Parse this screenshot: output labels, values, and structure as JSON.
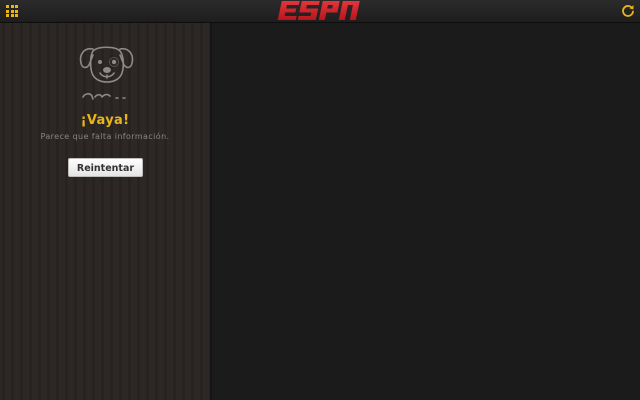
{
  "header": {
    "logo_text": "ESPN",
    "menu_icon": "grid-icon",
    "refresh_icon": "refresh-icon",
    "accent_color": "#e8b619",
    "logo_color": "#d3232a"
  },
  "sidebar": {
    "illustration": "dog-icon",
    "heading": "¡Vaya!",
    "message": "Parece que falta información.",
    "retry_label": "Reintentar"
  }
}
